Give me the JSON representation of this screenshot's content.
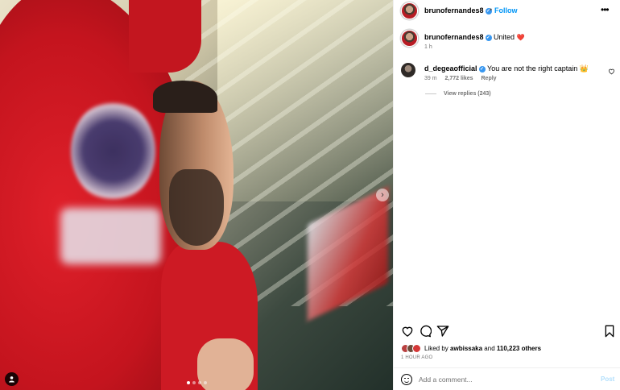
{
  "post": {
    "author": "brunofernandes8",
    "follow_label": "Follow",
    "separator": "•",
    "more_icon": "•••",
    "caption": {
      "username": "brunofernandes8",
      "text": "United",
      "emoji": "❤️",
      "time": "1 h"
    },
    "carousel": {
      "next_icon": "chevron-right-icon",
      "slide_count": 4,
      "active_slide": 1
    }
  },
  "comments": [
    {
      "username": "d_degeaofficial",
      "text": "You are not the right captain",
      "emoji": "👑",
      "time": "39 m",
      "likes": "2,772 likes",
      "reply_label": "Reply"
    }
  ],
  "replies_label": "View replies (243)",
  "likes_line": {
    "prefix": "Liked by",
    "user": "awbissaka",
    "and": "and",
    "others": "110,223 others"
  },
  "posted": "1 HOUR AGO",
  "add_comment": {
    "placeholder": "Add a comment...",
    "post_label": "Post"
  },
  "colors": {
    "accent": "#0095f6",
    "verified": "#3897f0",
    "muted": "#737373"
  }
}
